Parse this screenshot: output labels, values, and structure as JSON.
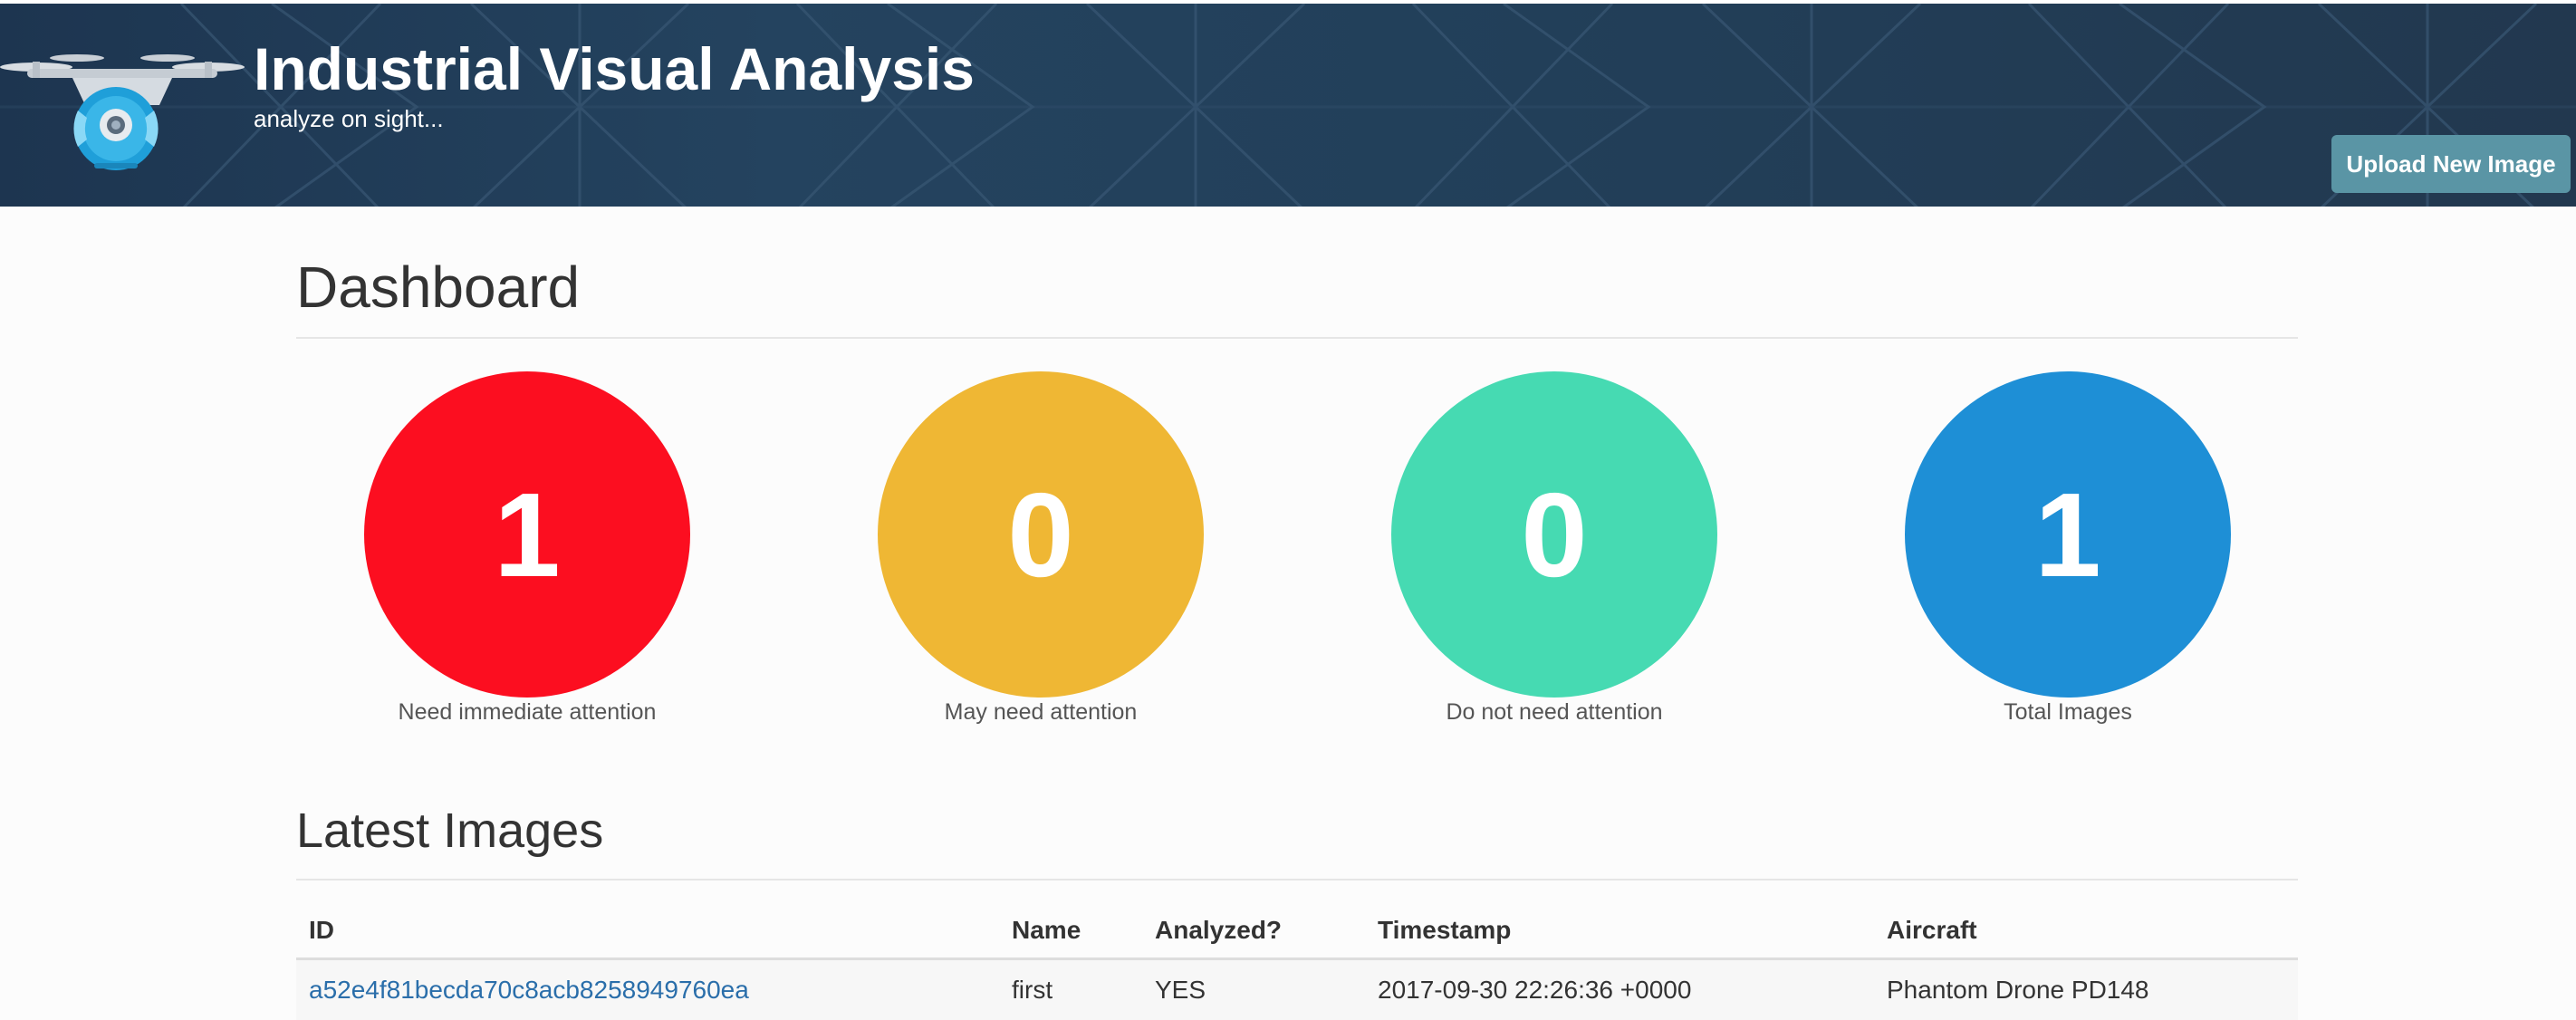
{
  "header": {
    "title": "Industrial Visual Analysis",
    "subtitle": "analyze on sight...",
    "upload_button": "Upload New Image",
    "logo_icon": "drone-icon",
    "colors": {
      "background": "#223f59",
      "upload_button": "#5a95a5",
      "logo_accent": "#3ab6e8"
    }
  },
  "dashboard": {
    "title": "Dashboard",
    "stats": [
      {
        "value": "1",
        "label": "Need immediate attention",
        "color": "#fc0e20"
      },
      {
        "value": "0",
        "label": "May need attention",
        "color": "#efb734"
      },
      {
        "value": "0",
        "label": "Do not need attention",
        "color": "#46dab2"
      },
      {
        "value": "1",
        "label": "Total Images",
        "color": "#1e8fd6"
      }
    ]
  },
  "latest_images": {
    "title": "Latest Images",
    "columns": [
      "ID",
      "Name",
      "Analyzed?",
      "Timestamp",
      "Aircraft"
    ],
    "rows": [
      {
        "id": "a52e4f81becda70c8acb8258949760ea",
        "name": "first",
        "analyzed": "YES",
        "timestamp": "2017-09-30 22:26:36 +0000",
        "aircraft": "Phantom Drone PD148"
      }
    ]
  }
}
